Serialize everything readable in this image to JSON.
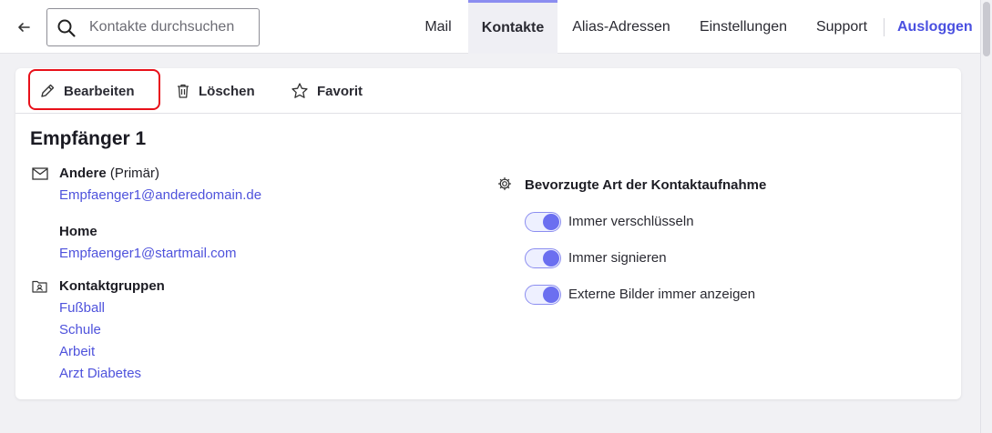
{
  "header": {
    "back_icon": "arrow-left-icon",
    "search": {
      "placeholder": "Kontakte durchsuchen",
      "value": ""
    },
    "nav": [
      {
        "label": "Mail",
        "active": false
      },
      {
        "label": "Kontakte",
        "active": true
      },
      {
        "label": "Alias-Adressen",
        "active": false
      },
      {
        "label": "Einstellungen",
        "active": false
      },
      {
        "label": "Support",
        "active": false
      }
    ],
    "logout_label": "Ausloggen"
  },
  "toolbar": {
    "edit_label": "Bearbeiten",
    "delete_label": "Löschen",
    "favorite_label": "Favorit"
  },
  "contact": {
    "name": "Empfänger 1",
    "emails": [
      {
        "label": "Andere",
        "note": "(Primär)",
        "address": "Empfaenger1@anderedomain.de"
      },
      {
        "label": "Home",
        "note": "",
        "address": "Empfaenger1@startmail.com"
      }
    ],
    "groups_label": "Kontaktgruppen",
    "groups": [
      "Fußball",
      "Schule",
      "Arbeit",
      "Arzt Diabetes"
    ]
  },
  "preferences": {
    "title": "Bevorzugte Art der Kontaktaufnahme",
    "options": [
      {
        "label": "Immer verschlüsseln",
        "enabled": true
      },
      {
        "label": "Immer signieren",
        "enabled": true
      },
      {
        "label": "Externe Bilder immer anzeigen",
        "enabled": true
      }
    ]
  },
  "colors": {
    "accent": "#4e52dc",
    "highlight": "#e8101a",
    "toggle": "#6b6ff0"
  }
}
